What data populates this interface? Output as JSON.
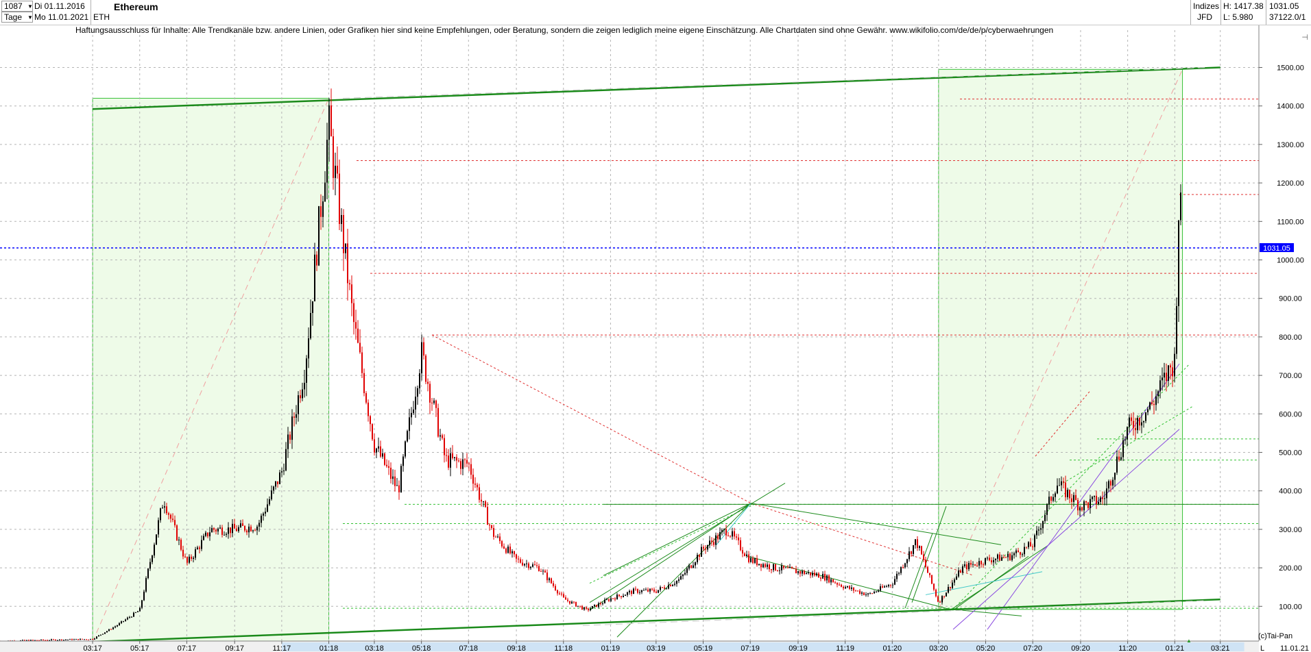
{
  "header": {
    "bars_count": "1087",
    "start_date": "Di 01.11.2016",
    "period": "Tage",
    "end_date": "Mo 11.01.2021",
    "symbol": "ETH",
    "title": "Ethereum",
    "category": "Indizes",
    "source": "JFD",
    "high_label": "H: 1417.38",
    "low_label": "L: 5.980",
    "last_value": "1031.05",
    "code": "37122.0/1"
  },
  "disclaimer": "Haftungsausschluss für Inhalte: Alle Trendkanäle bzw. andere Linien, oder Grafiken hier sind keine Empfehlungen, oder Beratung, sondern die zeigen lediglich meine eigene Einschätzung. Alle Chartdaten sind ohne Gewähr.  www.wikifolio.com/de/de/p/cyberwaehrungen",
  "footer": {
    "copyright": "(c)Tai-Pan",
    "date": "11.01.21",
    "scale_letter": "L"
  },
  "colors": {
    "up": "#000000",
    "down": "#e00000",
    "zone_fill": "#eefbe8",
    "zone_border": "#38c038",
    "trend_green": "#1a8a1a",
    "current_price_line": "#0000ff",
    "resistance": "#e03030",
    "support": "#30c030"
  },
  "chart_data": {
    "type": "candlestick",
    "title": "Ethereum",
    "ylim": [
      0,
      1540
    ],
    "y_ticks": [
      "100.00",
      "200.00",
      "300.00",
      "400.00",
      "500.00",
      "600.00",
      "700.00",
      "800.00",
      "900.00",
      "1000.00",
      "1100.00",
      "1200.00",
      "1300.00",
      "1400.00",
      "1500.00"
    ],
    "x_tick_labels": [
      "03:17",
      "05:17",
      "07:17",
      "09:17",
      "11:17",
      "01:18",
      "03:18",
      "05:18",
      "07:18",
      "09:18",
      "11:18",
      "01:19",
      "03:19",
      "05:19",
      "07:19",
      "09:19",
      "11:19",
      "01:20",
      "03:20",
      "05:20",
      "07:20",
      "09:20",
      "11:20",
      "01:21",
      "03:21"
    ],
    "current_price": 1031.05,
    "current_price_label": "1031.05",
    "price_path": [
      {
        "date": "2016-11",
        "value": 10
      },
      {
        "date": "2017-03",
        "value": 15
      },
      {
        "date": "2017-04",
        "value": 50
      },
      {
        "date": "2017-05",
        "value": 90
      },
      {
        "date": "2017-06",
        "value": 380
      },
      {
        "date": "2017-07",
        "value": 210
      },
      {
        "date": "2017-08",
        "value": 300
      },
      {
        "date": "2017-09",
        "value": 300
      },
      {
        "date": "2017-10",
        "value": 310
      },
      {
        "date": "2017-11",
        "value": 450
      },
      {
        "date": "2017-12",
        "value": 720
      },
      {
        "date": "2018-01",
        "value": 1350
      },
      {
        "date": "2018-02",
        "value": 850
      },
      {
        "date": "2018-03",
        "value": 520
      },
      {
        "date": "2018-04",
        "value": 400
      },
      {
        "date": "2018-05",
        "value": 760
      },
      {
        "date": "2018-06",
        "value": 480
      },
      {
        "date": "2018-07",
        "value": 470
      },
      {
        "date": "2018-08",
        "value": 290
      },
      {
        "date": "2018-09",
        "value": 220
      },
      {
        "date": "2018-10",
        "value": 200
      },
      {
        "date": "2018-11",
        "value": 120
      },
      {
        "date": "2018-12",
        "value": 90
      },
      {
        "date": "2019-01",
        "value": 120
      },
      {
        "date": "2019-02",
        "value": 140
      },
      {
        "date": "2019-03",
        "value": 140
      },
      {
        "date": "2019-04",
        "value": 170
      },
      {
        "date": "2019-05",
        "value": 250
      },
      {
        "date": "2019-06",
        "value": 300
      },
      {
        "date": "2019-07",
        "value": 220
      },
      {
        "date": "2019-08",
        "value": 200
      },
      {
        "date": "2019-09",
        "value": 190
      },
      {
        "date": "2019-10",
        "value": 180
      },
      {
        "date": "2019-11",
        "value": 150
      },
      {
        "date": "2019-12",
        "value": 130
      },
      {
        "date": "2020-01",
        "value": 160
      },
      {
        "date": "2020-02",
        "value": 270
      },
      {
        "date": "2020-03",
        "value": 110
      },
      {
        "date": "2020-04",
        "value": 200
      },
      {
        "date": "2020-05",
        "value": 220
      },
      {
        "date": "2020-06",
        "value": 230
      },
      {
        "date": "2020-07",
        "value": 260
      },
      {
        "date": "2020-08",
        "value": 420
      },
      {
        "date": "2020-09",
        "value": 360
      },
      {
        "date": "2020-10",
        "value": 380
      },
      {
        "date": "2020-11",
        "value": 560
      },
      {
        "date": "2020-12",
        "value": 620
      },
      {
        "date": "2021-01-01",
        "value": 740
      },
      {
        "date": "2021-01-07",
        "value": 1200
      },
      {
        "date": "2021-01-11",
        "value": 1031
      }
    ],
    "horizontal_levels": [
      {
        "value": 1418,
        "kind": "resistance"
      },
      {
        "value": 1258,
        "kind": "resistance"
      },
      {
        "value": 1170,
        "kind": "resistance"
      },
      {
        "value": 965,
        "kind": "resistance"
      },
      {
        "value": 805,
        "kind": "resistance"
      },
      {
        "value": 365,
        "kind": "support"
      },
      {
        "value": 315,
        "kind": "support"
      },
      {
        "value": 535,
        "kind": "support"
      },
      {
        "value": 480,
        "kind": "support"
      },
      {
        "value": 95,
        "kind": "support"
      }
    ],
    "zones": [
      {
        "start": "2017-03",
        "end": "2018-01",
        "low": 8,
        "high": 1420
      },
      {
        "start": "2020-03",
        "end": "2021-01-11",
        "low": 92,
        "high": 1495
      }
    ],
    "channel_lines": [
      {
        "from": {
          "date": "2017-03",
          "value": 1392
        },
        "to": {
          "date": "2021-03",
          "value": 1500
        }
      },
      {
        "from": {
          "date": "2017-03",
          "value": 8
        },
        "to": {
          "date": "2021-03",
          "value": 118
        }
      }
    ]
  }
}
